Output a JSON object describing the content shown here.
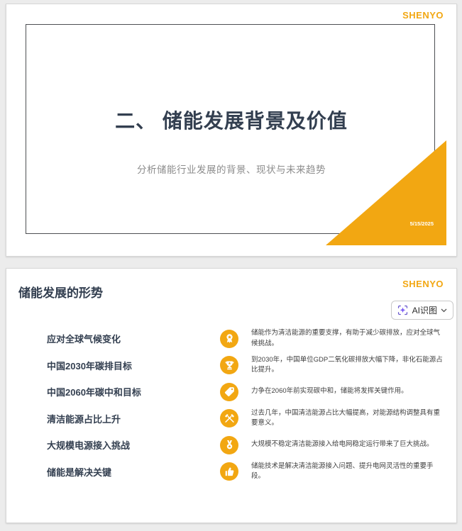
{
  "brand": {
    "logo": "SHENYO"
  },
  "colors": {
    "accent": "#F2A712",
    "heading": "#333F50",
    "body_text": "#3F3F3F",
    "subtitle": "#8C8C8C",
    "page_background": "#ECECEC"
  },
  "slide1": {
    "title": "二、 储能发展背景及价值",
    "subtitle": "分析储能行业发展的背景、现状与未来趋势",
    "date": "5/15/2025"
  },
  "slide2": {
    "title": "储能发展的形势",
    "ai_button": {
      "label": "AI识图"
    },
    "items": [
      {
        "label": "应对全球气候变化",
        "icon": "ribbon-medal-icon",
        "desc": "储能作为清洁能源的重要支撑，有助于减少碳排放，应对全球气候挑战。"
      },
      {
        "label": "中国2030年碳排目标",
        "icon": "trophy-icon",
        "desc": "到2030年，中国单位GDP二氧化碳排放大幅下降，非化石能源占比提升。"
      },
      {
        "label": "中国2060年碳中和目标",
        "icon": "price-tag-icon",
        "desc": "力争在2060年前实现碳中和，储能将发挥关键作用。"
      },
      {
        "label": "清洁能源占比上升",
        "icon": "crossed-hammers-icon",
        "desc": "过去几年，中国清洁能源占比大幅提高，对能源结构调整具有重要意义。"
      },
      {
        "label": "大规模电源接入挑战",
        "icon": "star-medal-icon",
        "desc": "大规模不稳定清洁能源接入给电网稳定运行带来了巨大挑战。"
      },
      {
        "label": "储能是解决关键",
        "icon": "thumbs-up-icon",
        "desc": "储能技术是解决清洁能源接入问题、提升电网灵活性的重要手段。"
      }
    ]
  }
}
